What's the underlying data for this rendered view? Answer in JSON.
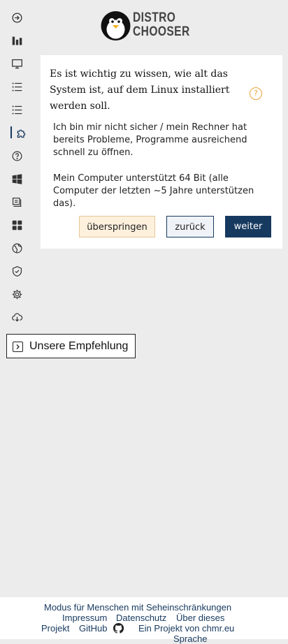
{
  "sidebar": {
    "items": [
      {
        "icon": "login-icon"
      },
      {
        "icon": "bar-chart-icon"
      },
      {
        "icon": "desktop-icon"
      },
      {
        "icon": "list-icon"
      },
      {
        "icon": "list-icon"
      },
      {
        "icon": "puzzle-icon",
        "active": true
      },
      {
        "icon": "question-circle-icon"
      },
      {
        "icon": "windows-icon"
      },
      {
        "icon": "checklist-icon"
      },
      {
        "icon": "grid-icon"
      },
      {
        "icon": "globe-icon"
      },
      {
        "icon": "shield-check-icon"
      },
      {
        "icon": "gear-icon"
      },
      {
        "icon": "cloud-download-icon"
      }
    ]
  },
  "logo": {
    "line1": "DISTRO",
    "line2": "CHOOSER"
  },
  "question": {
    "text": "Es ist wichtig zu wissen, wie alt das System ist, auf dem Linux installiert werden soll.",
    "help": "?"
  },
  "options": [
    "Ich bin mir nicht sicher / mein Rechner hat bereits Probleme, Programme ausreichend schnell zu öffnen.",
    "Mein Computer unterstützt 64 Bit (alle Computer der letzten ~5 Jahre unterstützen das)."
  ],
  "buttons": {
    "skip": "überspringen",
    "back": "zurück",
    "next": "weiter"
  },
  "recommendation": {
    "label": "Unsere Empfehlung"
  },
  "footer": {
    "accessibility": "Modus für Menschen mit Seheinschränkungen",
    "impressum": "Impressum",
    "privacy": "Datenschutz",
    "about_1": "Über dieses",
    "about_2": "Projekt",
    "github": "GitHub",
    "project_by": "Ein Projekt von chmr.eu",
    "language": "Sprache"
  },
  "colors": {
    "primary": "#16395f",
    "accent": "#e8a33a",
    "background": "#ececec"
  }
}
